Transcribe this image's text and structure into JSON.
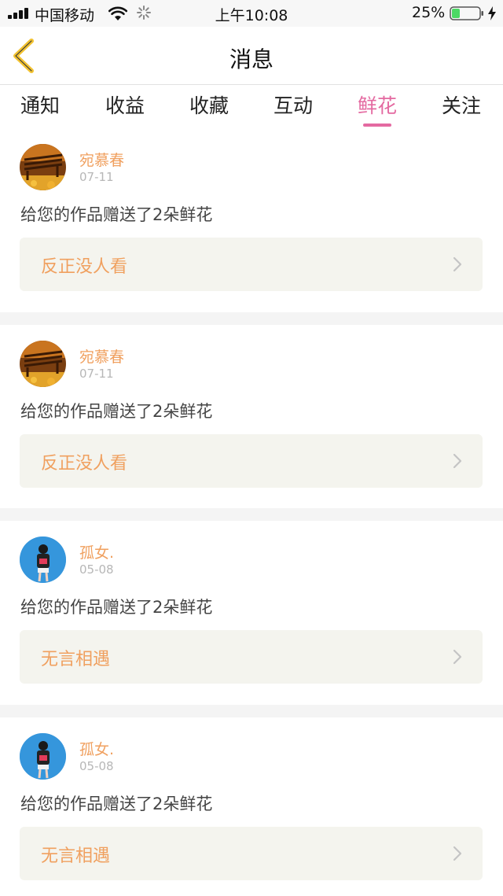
{
  "status_bar": {
    "carrier": "中国移动",
    "time": "上午10:08",
    "battery": "25%"
  },
  "header": {
    "title": "消息",
    "back_icon": "chevron-left-icon"
  },
  "tabs": [
    {
      "label": "通知",
      "active": false
    },
    {
      "label": "收益",
      "active": false
    },
    {
      "label": "收藏",
      "active": false
    },
    {
      "label": "互动",
      "active": false
    },
    {
      "label": "鲜花",
      "active": true
    },
    {
      "label": "关注",
      "active": false
    }
  ],
  "messages": [
    {
      "user": "宛慕春",
      "date": "07-11",
      "text": "给您的作品赠送了2朵鲜花",
      "work_title": "反正没人看",
      "avatar": "autumn-bench"
    },
    {
      "user": "宛慕春",
      "date": "07-11",
      "text": "给您的作品赠送了2朵鲜花",
      "work_title": "反正没人看",
      "avatar": "autumn-bench"
    },
    {
      "user": "孤女.",
      "date": "05-08",
      "text": "给您的作品赠送了2朵鲜花",
      "work_title": "无言相遇",
      "avatar": "girl-blue"
    },
    {
      "user": "孤女.",
      "date": "05-08",
      "text": "给您的作品赠送了2朵鲜花",
      "work_title": "无言相遇",
      "avatar": "girl-blue"
    }
  ],
  "colors": {
    "accent": "#e46aa1",
    "name_orange": "#f0a05f",
    "back_yellow": "#f2c230",
    "battery_green": "#4cd964"
  }
}
